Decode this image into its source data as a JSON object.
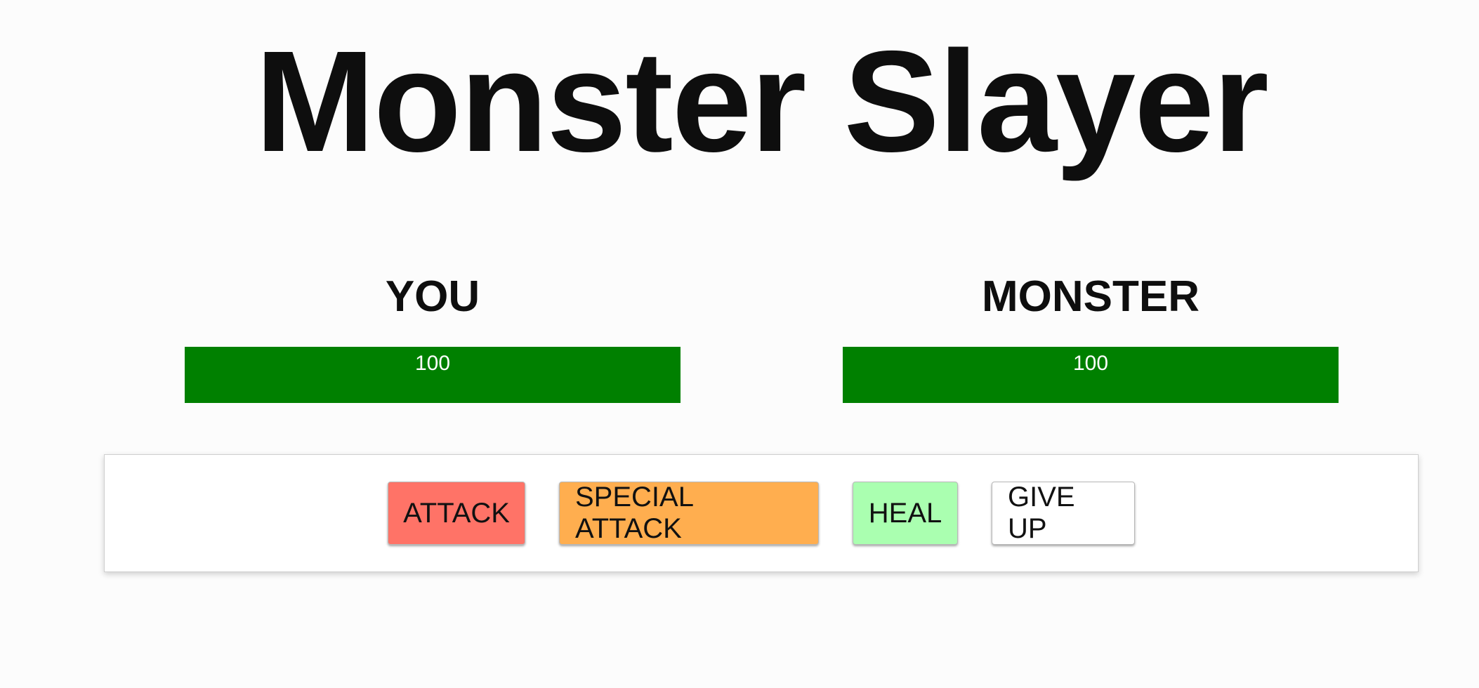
{
  "title": "Monster Slayer",
  "player": {
    "name": "YOU",
    "health": 100,
    "health_label": "100"
  },
  "monster": {
    "name": "MONSTER",
    "health": 100,
    "health_label": "100"
  },
  "controls": {
    "attack_label": "ATTACK",
    "special_attack_label": "SPECIAL ATTACK",
    "heal_label": "HEAL",
    "give_up_label": "GIVE UP"
  },
  "colors": {
    "health_bar": "#008000",
    "attack_button": "#ff7367",
    "special_attack_button": "#ffae4f",
    "heal_button": "#aaffb0",
    "give_up_button": "#ffffff"
  }
}
